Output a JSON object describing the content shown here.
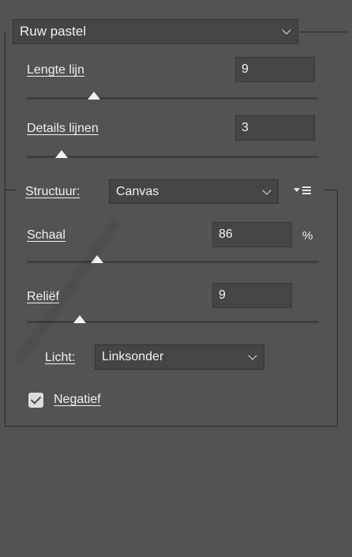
{
  "filter_dropdown": {
    "value": "Ruw pastel"
  },
  "stroke_length": {
    "label": "Lengte lijn",
    "value": "9",
    "slider": 0.23
  },
  "stroke_detail": {
    "label": "Details lijnen",
    "value": "3",
    "slider": 0.12
  },
  "texture": {
    "label": "Structuur:",
    "value": "Canvas",
    "menu_icon": "flyout-menu-icon",
    "scaling": {
      "label": "Schaal",
      "value": "86",
      "unit": "%",
      "slider": 0.24
    },
    "relief": {
      "label": "Reliëf",
      "value": "9",
      "slider": 0.18
    },
    "light": {
      "label": "Licht:",
      "value": "Linksonder"
    },
    "invert": {
      "label": "Negatief",
      "checked": true
    }
  },
  "colors": {
    "background": "#535353",
    "field": "#454545",
    "border": "#2b2b2b",
    "thumb": "#f2f2f2"
  }
}
